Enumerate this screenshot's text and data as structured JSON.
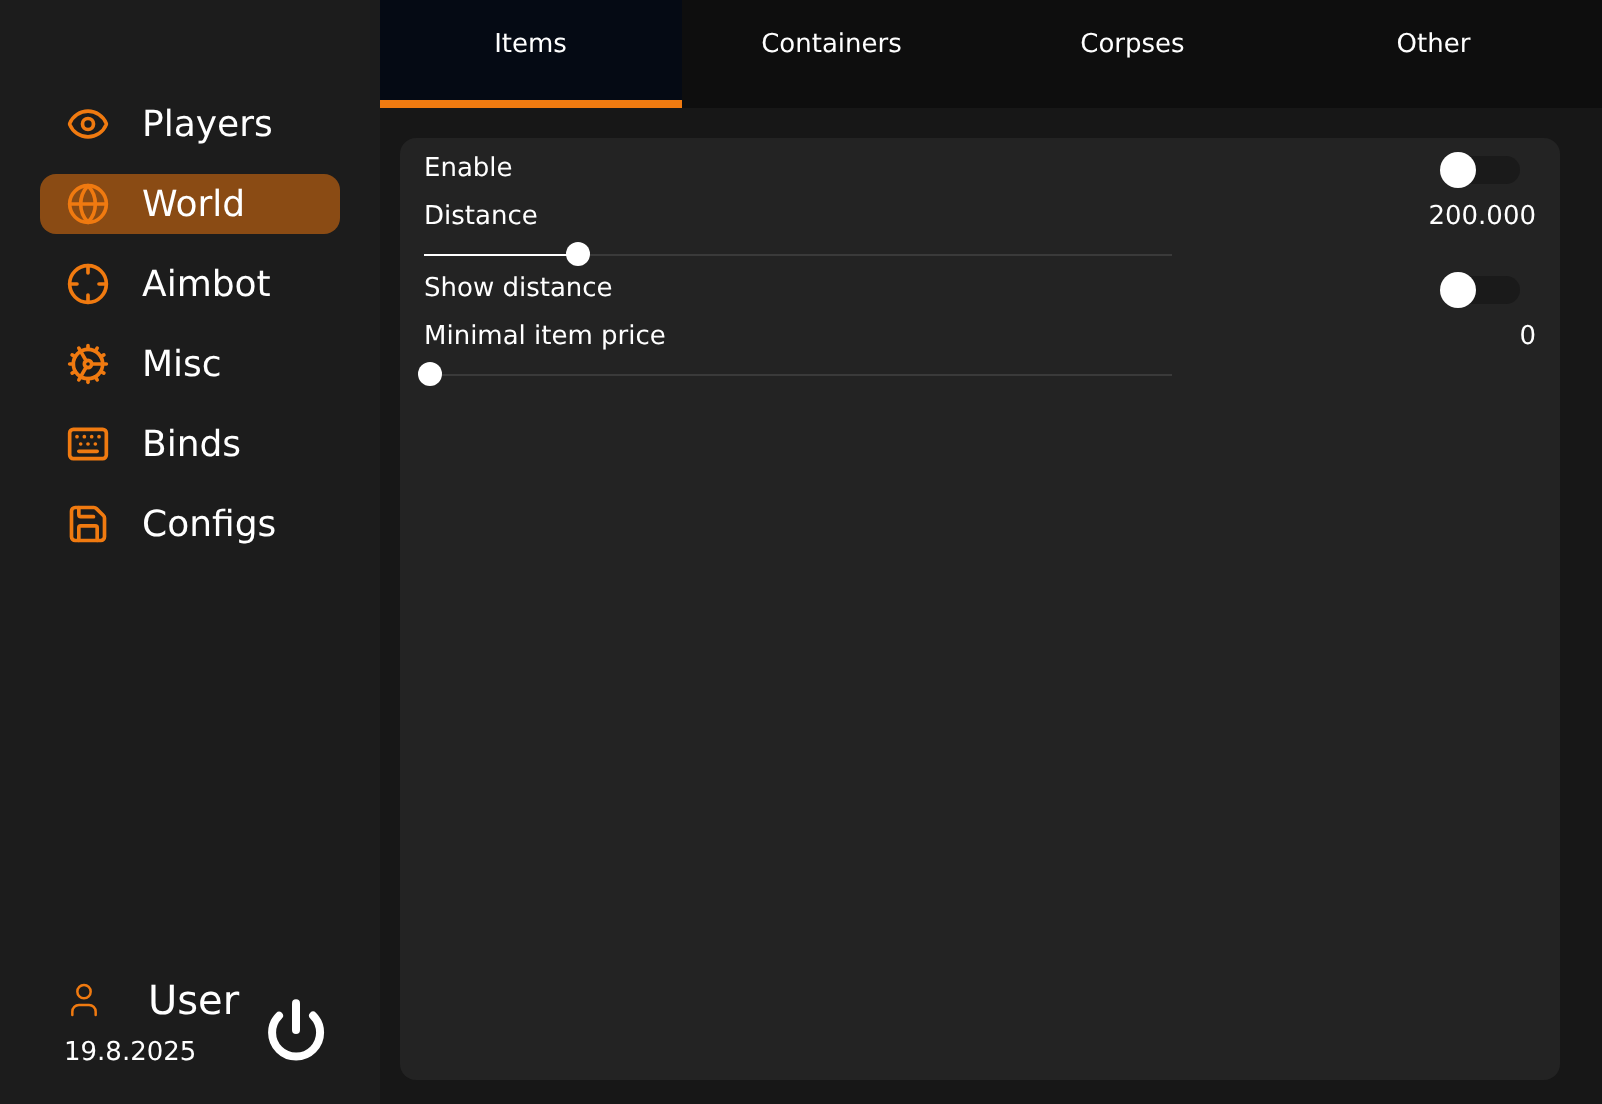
{
  "sidebar": {
    "items": [
      {
        "label": "Players",
        "selected": false
      },
      {
        "label": "World",
        "selected": true
      },
      {
        "label": "Aimbot",
        "selected": false
      },
      {
        "label": "Misc",
        "selected": false
      },
      {
        "label": "Binds",
        "selected": false
      },
      {
        "label": "Configs",
        "selected": false
      }
    ],
    "user": {
      "name": "User",
      "date": "19.8.2025"
    }
  },
  "tabs": [
    {
      "label": "Items",
      "selected": true
    },
    {
      "label": "Containers",
      "selected": false
    },
    {
      "label": "Corpses",
      "selected": false
    },
    {
      "label": "Other",
      "selected": false
    }
  ],
  "settings": [
    {
      "kind": "toggle",
      "label": "Enable",
      "on": false
    },
    {
      "kind": "slider",
      "label": "Distance",
      "reading": "200.000",
      "level": 0.2
    },
    {
      "kind": "toggle",
      "label": "Show distance",
      "on": false
    },
    {
      "kind": "slider",
      "label": "Minimal item price",
      "reading": "0",
      "level": 0
    }
  ]
}
